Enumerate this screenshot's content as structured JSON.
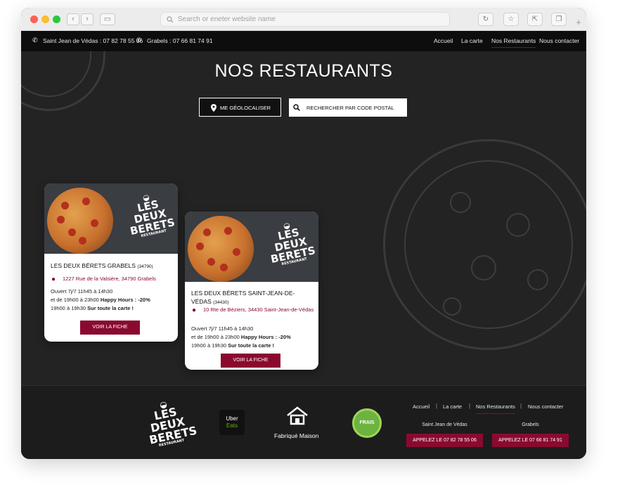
{
  "browser": {
    "url_placeholder": "Search or eneter website name"
  },
  "topbar": {
    "phone_1": "Saint Jean de Védas : 07 82 78 55 06",
    "phone_2": "Grabels : 07 66 81 74 91",
    "nav": [
      "Accueil",
      "La carte",
      "Nos Restaurants",
      "Nous contacter"
    ]
  },
  "hero": {
    "title": "NOS RESTAURANTS",
    "geo_button": "ME GÉOLOCALISER",
    "search_button": "RECHERCHER PAR CODE POSTAL"
  },
  "logo": {
    "line1": "LES",
    "line2": "DEUX",
    "line3": "BERETS",
    "line4": "RESTAURANT"
  },
  "restaurants": [
    {
      "name": "LES DEUX BÉRETS GRABELS",
      "code": "(34790)",
      "address": "1227 Rue de la Valsière, 34790 Grabels",
      "hours_1": "Ouvert 7j/7 11h45 à 14h30",
      "hours_2a": "et de 19h00 à 23h00 ",
      "hours_2b": "Happy Hours : -20%",
      "hours_3a": "19h00 à 19h30 ",
      "hours_3b": "Sur toute la carte !",
      "button": "VOIR LA FICHE"
    },
    {
      "name": "LES DEUX BÉRETS SAINT-JEAN-DE-VÉDAS",
      "code": "(34430)",
      "address": "10 Rte de Béziers, 34430 Saint-Jean-de-Védas",
      "hours_1": "Ouvert 7j/7 11h45 à 14h30",
      "hours_2a": "et de 19h00 à 23h00 ",
      "hours_2b": "Happy Hours : -20%",
      "hours_3a": "19h00 à 19h30 ",
      "hours_3b": "Sur toute la carte !",
      "button": "VOIR LA FICHE"
    }
  ],
  "footer": {
    "uber_1": "Uber",
    "uber_2": "Eats",
    "fabrique": "Fabriqué Maison",
    "frais": "FRAIS",
    "nav": [
      "Accueil",
      "La carte",
      "Nos Restaurants",
      "Nous contacter"
    ],
    "city_1": "Saint Jean de Védas",
    "city_2": "Grabels",
    "call_1": "APPELEZ LE 07 82 78 55 06",
    "call_2": "APPELEZ LE 07 66 81 74 91"
  },
  "colors": {
    "accent": "#8a0a2f",
    "background": "#232323",
    "topbar": "#0d0d0d"
  }
}
